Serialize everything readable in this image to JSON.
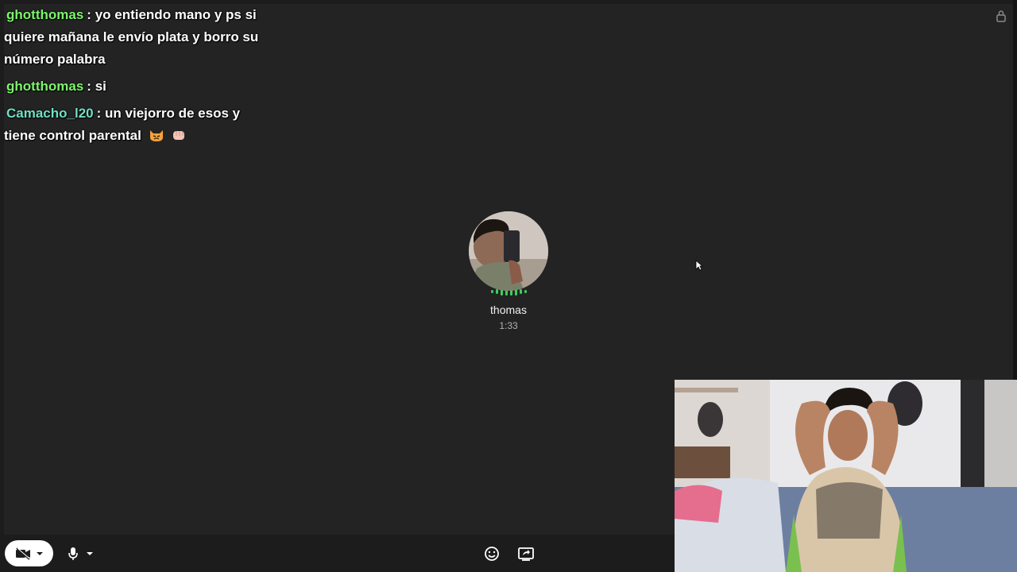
{
  "chat": {
    "messages": [
      {
        "user": "ghotthomas",
        "user_color": "#7cf56b",
        "text": "yo entiendo mano y ps si quiere mañana le envío plata y borro su número palabra"
      },
      {
        "user": "ghotthomas",
        "user_color": "#7cf56b",
        "text": "si"
      },
      {
        "user": "Camacho_l20",
        "user_color": "#6fe0c4",
        "text": "un viejorro de esos y tiene control parental",
        "emojis": [
          "pouting-cat-emoji",
          "fist-emoji"
        ]
      }
    ],
    "separator": ":"
  },
  "call": {
    "caller_name": "thomas",
    "duration": "1:33",
    "speaking_color": "#3cd15b"
  },
  "toolbar": {
    "camera_icon": "camera-off-icon",
    "mic_icon": "mic-icon",
    "emoji_icon": "smiley-icon",
    "share_icon": "screen-share-icon"
  },
  "window": {
    "lock_icon": "lock-icon"
  }
}
